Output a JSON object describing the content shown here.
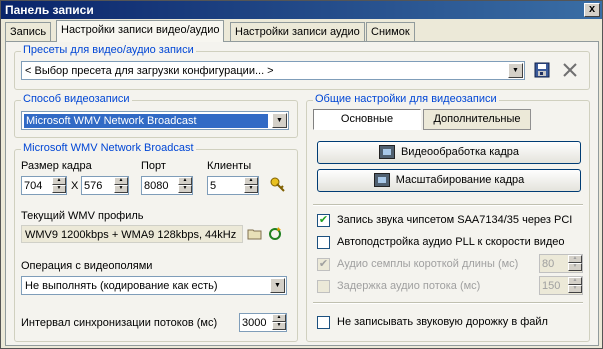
{
  "window": {
    "title": "Панель записи",
    "close_label": "x"
  },
  "tabs": [
    {
      "label": "Запись",
      "active": false
    },
    {
      "label": "Настройки записи видео/аудио",
      "active": true
    },
    {
      "label": "Настройки записи аудио",
      "active": false
    },
    {
      "label": "Снимок",
      "active": false
    }
  ],
  "presets": {
    "title": "Пресеты для видео/аудио записи",
    "selected": "< Выбор пресета для загрузки конфигурации... >"
  },
  "capture_method": {
    "title": "Способ видеозаписи",
    "selected": "Microsoft WMV Network Broadcast"
  },
  "wmv": {
    "title": "Microsoft WMV Network Broadcast",
    "frame_size_label": "Размер кадра",
    "width": "704",
    "x_label": "X",
    "height": "576",
    "port_label": "Порт",
    "port": "8080",
    "clients_label": "Клиенты",
    "clients": "5",
    "profile_label": "Текущий WMV профиль",
    "profile_value": "WMV9 1200kbps + WMA9 128kbps, 44kHz",
    "field_op_label": "Операция с видеополями",
    "field_op_value": "Не выполнять (кодирование как есть)",
    "sync_label": "Интервал синхронизации потоков (мс)",
    "sync_value": "3000"
  },
  "general": {
    "title": "Общие настройки для видеозаписи",
    "tab_basic": "Основные",
    "tab_advanced": "Дополнительные",
    "video_processing_button": "Видеообработка кадра",
    "scaling_button": "Масштабирование кадра",
    "options": [
      {
        "label": "Запись звука чипсетом SAA7134/35 через PCI",
        "checked": true,
        "disabled": false
      },
      {
        "label": "Автоподстройка аудио PLL к скорости видео",
        "checked": false,
        "disabled": false
      },
      {
        "label": "Аудио семплы короткой длины (мс)",
        "checked": true,
        "disabled": true,
        "value": "80"
      },
      {
        "label": "Задержка аудио потока (мс)",
        "checked": false,
        "disabled": true,
        "value": "150"
      }
    ],
    "no_audio_label": "Не записывать звуковую дорожку в файл",
    "no_audio_checked": false
  },
  "colors": {
    "group_title": "#0046d5",
    "selection": "#316ac5",
    "titlebar": "#0a246a"
  }
}
